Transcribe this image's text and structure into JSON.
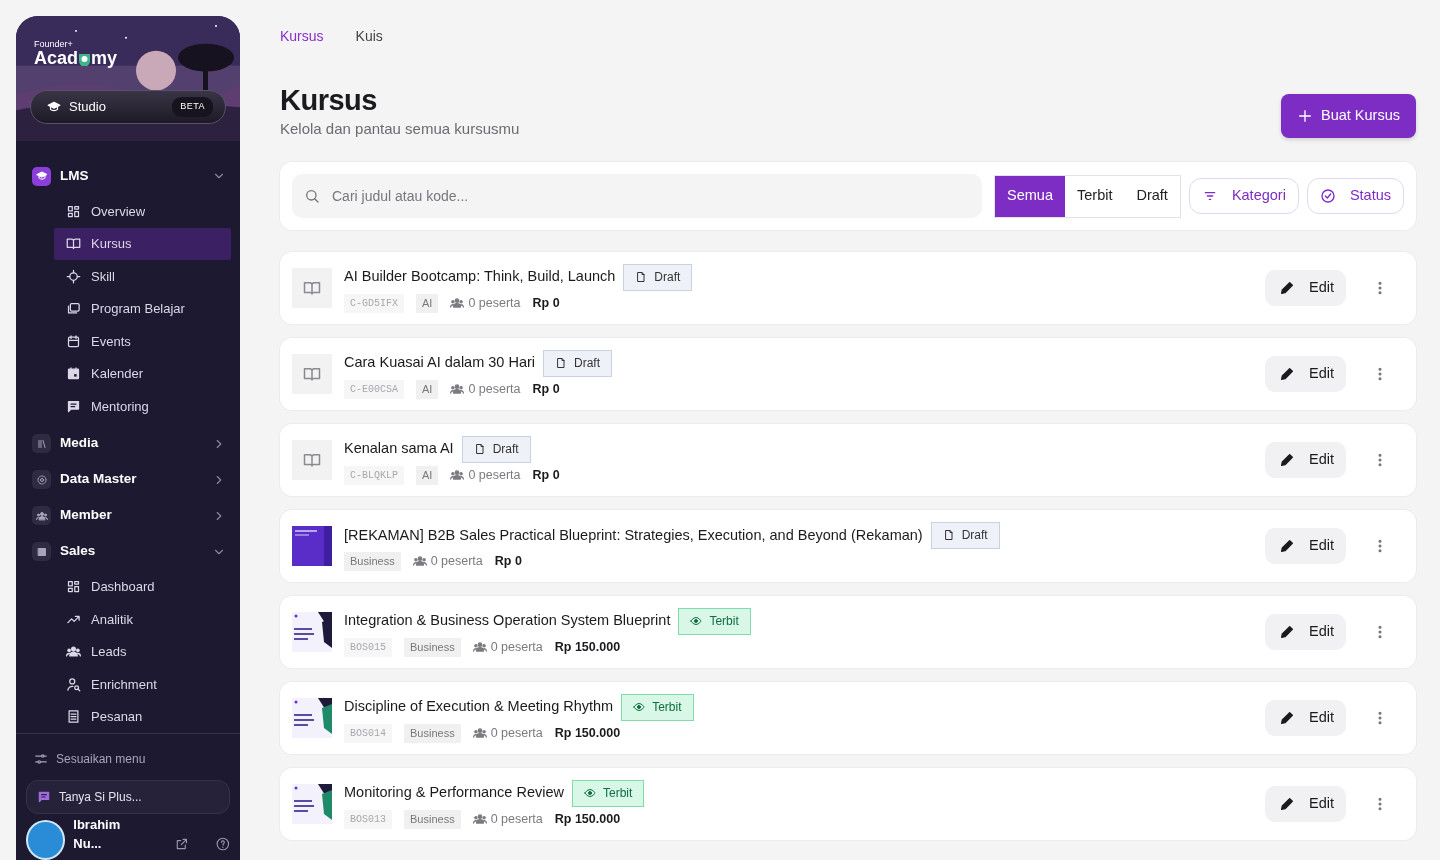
{
  "sidebar": {
    "logo": {
      "small": "Founder+",
      "part1": "Acad",
      "part2": "my"
    },
    "studio": {
      "label": "Studio",
      "badge": "BETA"
    },
    "groups": [
      {
        "label": "LMS",
        "expanded": true,
        "children": [
          {
            "label": "Overview",
            "selected": false
          },
          {
            "label": "Kursus",
            "selected": true
          },
          {
            "label": "Skill",
            "selected": false
          },
          {
            "label": "Program Belajar",
            "selected": false
          },
          {
            "label": "Events",
            "selected": false
          },
          {
            "label": "Kalender",
            "selected": false
          },
          {
            "label": "Mentoring",
            "selected": false
          }
        ]
      },
      {
        "label": "Media",
        "expanded": false
      },
      {
        "label": "Data Master",
        "expanded": false
      },
      {
        "label": "Member",
        "expanded": false
      },
      {
        "label": "Sales",
        "expanded": true,
        "children": [
          {
            "label": "Dashboard",
            "selected": false
          },
          {
            "label": "Analitik",
            "selected": false
          },
          {
            "label": "Leads",
            "selected": false
          },
          {
            "label": "Enrichment",
            "selected": false
          },
          {
            "label": "Pesanan",
            "selected": false
          }
        ]
      }
    ],
    "customize": "Sesuaikan menu",
    "ask": "Tanya Si Plus...",
    "user": "Ibrahim Nu..."
  },
  "tabs": [
    {
      "label": "Kursus",
      "selected": true
    },
    {
      "label": "Kuis",
      "selected": false
    }
  ],
  "title": "Kursus",
  "subtitle": "Kelola dan pantau semua kursusmu",
  "create_button": "Buat Kursus",
  "search": {
    "placeholder": "Cari judul atau kode..."
  },
  "segments": [
    {
      "label": "Semua",
      "selected": true
    },
    {
      "label": "Terbit",
      "selected": false
    },
    {
      "label": "Draft",
      "selected": false
    }
  ],
  "filters": [
    "Kategori",
    "Status"
  ],
  "courses": [
    {
      "kind": "icon",
      "title": "AI Builder Bootcamp: Think, Build, Launch",
      "status": {
        "label": "Draft",
        "kind": "draft"
      },
      "code": "C-GD5IFX",
      "category": "AI",
      "participants": "0 peserta",
      "price": "Rp 0",
      "edit": "Edit"
    },
    {
      "kind": "icon",
      "title": "Cara Kuasai AI dalam 30 Hari",
      "status": {
        "label": "Draft",
        "kind": "draft"
      },
      "code": "C-E00CSA",
      "category": "AI",
      "participants": "0 peserta",
      "price": "Rp 0",
      "edit": "Edit"
    },
    {
      "kind": "icon",
      "title": "Kenalan sama AI",
      "status": {
        "label": "Draft",
        "kind": "draft"
      },
      "code": "C-BLQKLP",
      "category": "AI",
      "participants": "0 peserta",
      "price": "Rp 0",
      "edit": "Edit"
    },
    {
      "kind": "picture",
      "title": "[REKAMAN] B2B Sales Practical Blueprint: Strategies, Execution, and Beyond (Rekaman)",
      "status": {
        "label": "Draft",
        "kind": "draft"
      },
      "category": "Business",
      "participants": "0 peserta",
      "price": "Rp 0",
      "edit": "Edit"
    },
    {
      "kind": "picture",
      "title": "Integration & Business Operation System Blueprint",
      "status": {
        "label": "Terbit",
        "kind": "published"
      },
      "code": "BOS015",
      "category": "Business",
      "participants": "0 peserta",
      "price": "Rp 150.000",
      "edit": "Edit"
    },
    {
      "kind": "picture",
      "title": "Discipline of Execution & Meeting Rhythm",
      "status": {
        "label": "Terbit",
        "kind": "published"
      },
      "code": "BOS014",
      "category": "Business",
      "participants": "0 peserta",
      "price": "Rp 150.000",
      "edit": "Edit"
    },
    {
      "kind": "picture",
      "title": "Monitoring & Performance Review",
      "status": {
        "label": "Terbit",
        "kind": "published"
      },
      "code": "BOS013",
      "category": "Business",
      "participants": "0 peserta",
      "price": "Rp 150.000",
      "edit": "Edit"
    }
  ]
}
